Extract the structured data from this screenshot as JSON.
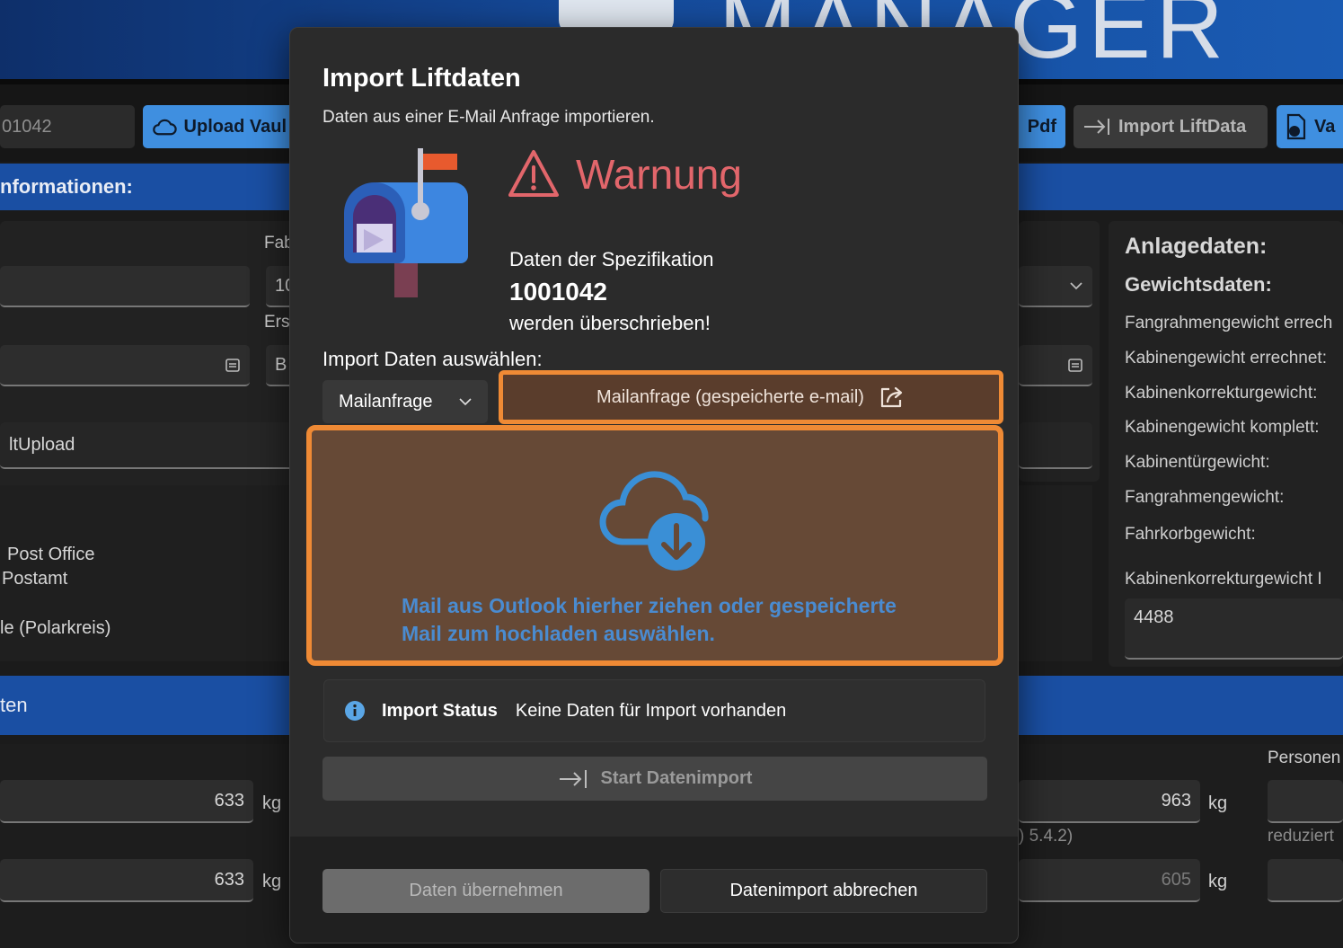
{
  "background": {
    "header": {
      "logo_text": "MANAGER"
    },
    "toolbar": {
      "spec_field": "01042",
      "upload_button": "Upload Vaul",
      "pdf_button": "Pdf",
      "import_button": "Import LiftData",
      "validate_button": "Va"
    },
    "section_info": "nformationen:",
    "left_form": {
      "label_fab": "Fab",
      "value_fab": "10",
      "label_ers": "Ers",
      "value_b": "B",
      "upload_row": "ltUpload",
      "address_line1": "Post Office",
      "address_line2": "Postamt",
      "address_line3": "le (Polarkreis)"
    },
    "section_data": "ten",
    "weights_left": [
      {
        "value": "633",
        "unit": "kg"
      },
      {
        "value": "633",
        "unit": "kg"
      }
    ],
    "weights_mid": [
      {
        "value": "963",
        "unit": "kg"
      },
      {
        "value": "605",
        "unit": "kg"
      }
    ],
    "mid_note": ") 5.4.2)",
    "right_panel": {
      "heading": "Anlagedaten:",
      "subheading": "Gewichtsdaten:",
      "items": [
        "Fangrahmengewicht errech",
        "Kabinengewicht errechnet:",
        "Kabinenkorrekturgewicht:",
        "Kabinengewicht komplett:",
        "Kabinentürgewicht:",
        "Fangrahmengewicht:",
        "Fahrkorbgewicht:"
      ],
      "correction_label": "Kabinenkorrekturgewicht I",
      "correction_value": "4488"
    },
    "persons_label": "Personen",
    "reduced_label": "reduziert"
  },
  "dialog": {
    "title": "Import Liftdaten",
    "subtitle": "Daten aus einer E-Mail Anfrage importieren.",
    "warning_title": "Warnung",
    "spec_label": "Daten der Spezifikation",
    "spec_number": "1001042",
    "spec_overwrite": "werden überschrieben!",
    "select_label": "Import Daten auswählen:",
    "dropdown_value": "Mailanfrage",
    "mail_button": "Mailanfrage (gespeicherte e-mail)",
    "drop_zone_text": "Mail aus Outlook hierher ziehen oder gespeicherte Mail zum hochladen auswählen.",
    "status_title": "Import Status",
    "status_text": "Keine Daten für Import vorhanden",
    "start_button": "Start Datenimport",
    "accept_button": "Daten übernehmen",
    "cancel_button": "Datenimport abbrechen"
  },
  "colors": {
    "highlight": "#ef8a35",
    "warning": "#e2666b",
    "link_blue": "#4a8bd0",
    "header_blue": "#1a4fa3"
  },
  "icons": [
    "mailbox-icon",
    "warning-icon",
    "share-icon",
    "cloud-download-icon",
    "info-icon",
    "import-arrow-icon",
    "cloud-icon",
    "calendar-icon",
    "chevron-down-icon"
  ]
}
